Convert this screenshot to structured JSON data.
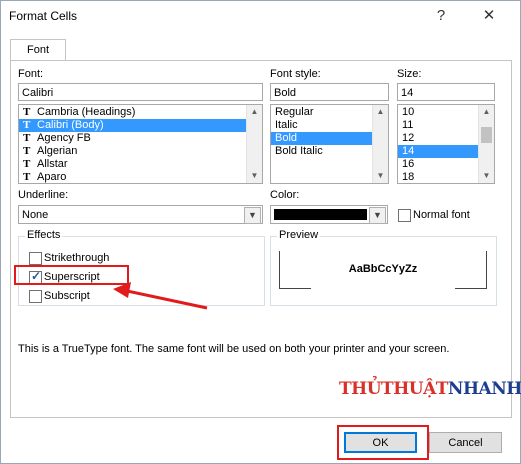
{
  "dialog": {
    "title": "Format Cells",
    "help_glyph": "?",
    "close_glyph": "✕"
  },
  "tabs": [
    {
      "label": "Font"
    }
  ],
  "font": {
    "label": "Font:",
    "value": "Calibri",
    "items": [
      {
        "label": "Cambria (Headings)",
        "icon": "truetype-icon"
      },
      {
        "label": "Calibri (Body)",
        "icon": "truetype-icon",
        "selected": true
      },
      {
        "label": "Agency FB",
        "icon": "truetype-icon"
      },
      {
        "label": "Algerian",
        "icon": "truetype-icon"
      },
      {
        "label": "Allstar",
        "icon": "truetype-icon"
      },
      {
        "label": "Aparo",
        "icon": "truetype-icon"
      }
    ]
  },
  "font_style": {
    "label": "Font style:",
    "value": "Bold",
    "items": [
      "Regular",
      "Italic",
      "Bold",
      "Bold Italic"
    ],
    "selected": "Bold"
  },
  "size": {
    "label": "Size:",
    "value": "14",
    "items": [
      "10",
      "11",
      "12",
      "14",
      "16",
      "18"
    ],
    "selected": "14"
  },
  "underline": {
    "label": "Underline:",
    "value": "None"
  },
  "color": {
    "label": "Color:",
    "value_color": "#000000"
  },
  "normal_font": {
    "label": "Normal font",
    "checked": false
  },
  "effects": {
    "title": "Effects",
    "strikethrough": {
      "label": "Strikethrough",
      "checked": false
    },
    "superscript": {
      "label": "Superscript",
      "checked": true
    },
    "subscript": {
      "label": "Subscript",
      "checked": false
    }
  },
  "preview": {
    "title": "Preview",
    "sample": "AaBbCcYyZz"
  },
  "info_text": "This is a TrueType font.  The same font will be used on both your printer and your screen.",
  "buttons": {
    "ok": "OK",
    "cancel": "Cancel"
  },
  "watermark": {
    "part1": "THỦTHUẬT",
    "part2": "NHANH"
  },
  "colors": {
    "selection": "#3399ff",
    "highlight": "#e11b1b",
    "arrow": "#e11b1b",
    "watermark1": "#d9302a",
    "watermark2": "#1e3f8f"
  }
}
